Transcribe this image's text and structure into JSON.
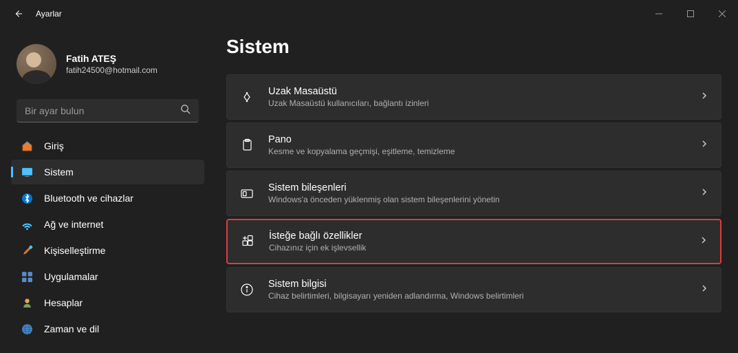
{
  "titlebar": {
    "title": "Ayarlar"
  },
  "user": {
    "name": "Fatih ATEŞ",
    "email": "fatih24500@hotmail.com"
  },
  "search": {
    "placeholder": "Bir ayar bulun"
  },
  "nav": {
    "home": "Giriş",
    "system": "Sistem",
    "bluetooth": "Bluetooth ve cihazlar",
    "network": "Ağ ve internet",
    "personalize": "Kişiselleştirme",
    "apps": "Uygulamalar",
    "accounts": "Hesaplar",
    "time": "Zaman ve dil"
  },
  "page": {
    "title": "Sistem"
  },
  "settings": {
    "remote": {
      "title": "Uzak Masaüstü",
      "subtitle": "Uzak Masaüstü kullanıcıları, bağlantı izinleri"
    },
    "clipboard": {
      "title": "Pano",
      "subtitle": "Kesme ve kopyalama geçmişi, eşitleme, temizleme"
    },
    "components": {
      "title": "Sistem bileşenleri",
      "subtitle": "Windows'a önceden yüklenmiş olan sistem bileşenlerini yönetin"
    },
    "optional": {
      "title": "İsteğe bağlı özellikler",
      "subtitle": "Cihazınız için ek işlevsellik"
    },
    "about": {
      "title": "Sistem bilgisi",
      "subtitle": "Cihaz belirtimleri, bilgisayarı yeniden adlandırma, Windows belirtimleri"
    }
  }
}
